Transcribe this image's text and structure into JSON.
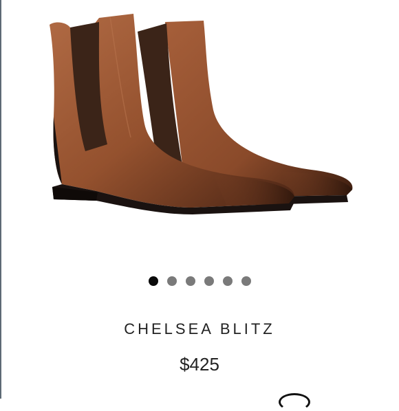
{
  "product": {
    "name": "CHELSEA BLITZ",
    "price": "$425"
  },
  "gallery": {
    "image_icon": "chelsea-boots-image",
    "dot_count": 6,
    "active_index": 0
  },
  "colors": {
    "leather": "#8a4a2a",
    "elastic": "#3b2418",
    "sole": "#1a1210",
    "dot_active": "#0a0a0a",
    "dot_inactive": "#7a7a7a"
  }
}
